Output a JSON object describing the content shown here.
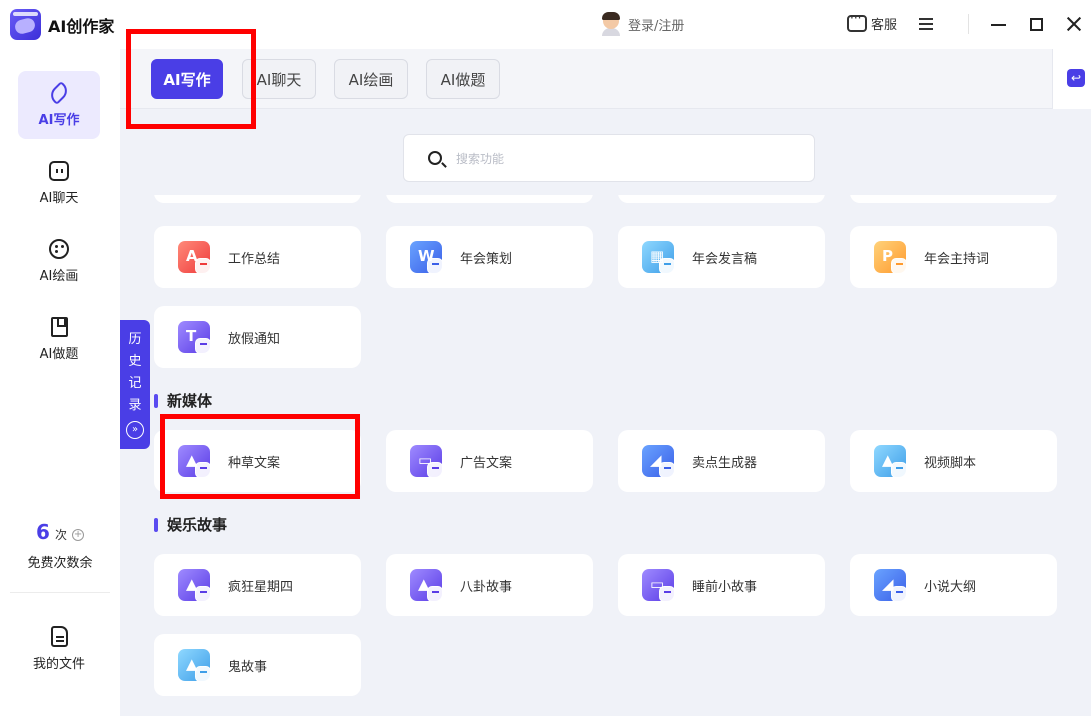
{
  "app": {
    "title": "AI创作家"
  },
  "user": {
    "login_label": "登录/注册"
  },
  "titlebar": {
    "service_label": "客服"
  },
  "sidebar": {
    "items": [
      {
        "label": "AI写作",
        "icon": "pen-icon",
        "active": true
      },
      {
        "label": "AI聊天",
        "icon": "chat-icon",
        "active": false
      },
      {
        "label": "AI绘画",
        "icon": "palette-icon",
        "active": false
      },
      {
        "label": "AI做题",
        "icon": "book-icon",
        "active": false
      }
    ],
    "free_count": "6",
    "free_unit": "次",
    "free_label": "免费次数余",
    "files_label": "我的文件"
  },
  "history": {
    "chars": [
      "历",
      "史",
      "记",
      "录"
    ]
  },
  "tabs": [
    {
      "label": "AI写作",
      "active": true
    },
    {
      "label": "AI聊天",
      "active": false
    },
    {
      "label": "AI绘画",
      "active": false
    },
    {
      "label": "AI做题",
      "active": false
    }
  ],
  "search": {
    "placeholder": "搜索功能",
    "value": ""
  },
  "sections": [
    {
      "title": "",
      "items": [
        {
          "label": "工作总结",
          "icon": "work-summary-icon",
          "color": "#ef3b3b"
        },
        {
          "label": "年会策划",
          "icon": "annual-plan-icon",
          "color": "#3a5fe8"
        },
        {
          "label": "年会发言稿",
          "icon": "annual-speech-icon",
          "color": "#3e9ee8"
        },
        {
          "label": "年会主持词",
          "icon": "host-script-icon",
          "color": "#ff9a2e"
        },
        {
          "label": "放假通知",
          "icon": "holiday-notice-icon",
          "color": "#5a3ce6"
        }
      ]
    },
    {
      "title": "新媒体",
      "items": [
        {
          "label": "种草文案",
          "icon": "seeding-copy-icon",
          "color": "#5a3ce6"
        },
        {
          "label": "广告文案",
          "icon": "ad-copy-icon",
          "color": "#5a3ce6"
        },
        {
          "label": "卖点生成器",
          "icon": "selling-point-icon",
          "color": "#3a5fe8"
        },
        {
          "label": "视频脚本",
          "icon": "video-script-icon",
          "color": "#3e9ee8"
        }
      ]
    },
    {
      "title": "娱乐故事",
      "items": [
        {
          "label": "疯狂星期四",
          "icon": "crazy-thursday-icon",
          "color": "#5a3ce6"
        },
        {
          "label": "八卦故事",
          "icon": "gossip-story-icon",
          "color": "#5a3ce6"
        },
        {
          "label": "睡前小故事",
          "icon": "bedtime-story-icon",
          "color": "#5a3ce6"
        },
        {
          "label": "小说大纲",
          "icon": "novel-outline-icon",
          "color": "#3a5fe8"
        },
        {
          "label": "鬼故事",
          "icon": "ghost-story-icon",
          "color": "#3e9ee8"
        }
      ]
    }
  ],
  "colors": {
    "accent": "#4a3ee6",
    "annotation": "#ff0000",
    "background": "#f0f2f8"
  }
}
